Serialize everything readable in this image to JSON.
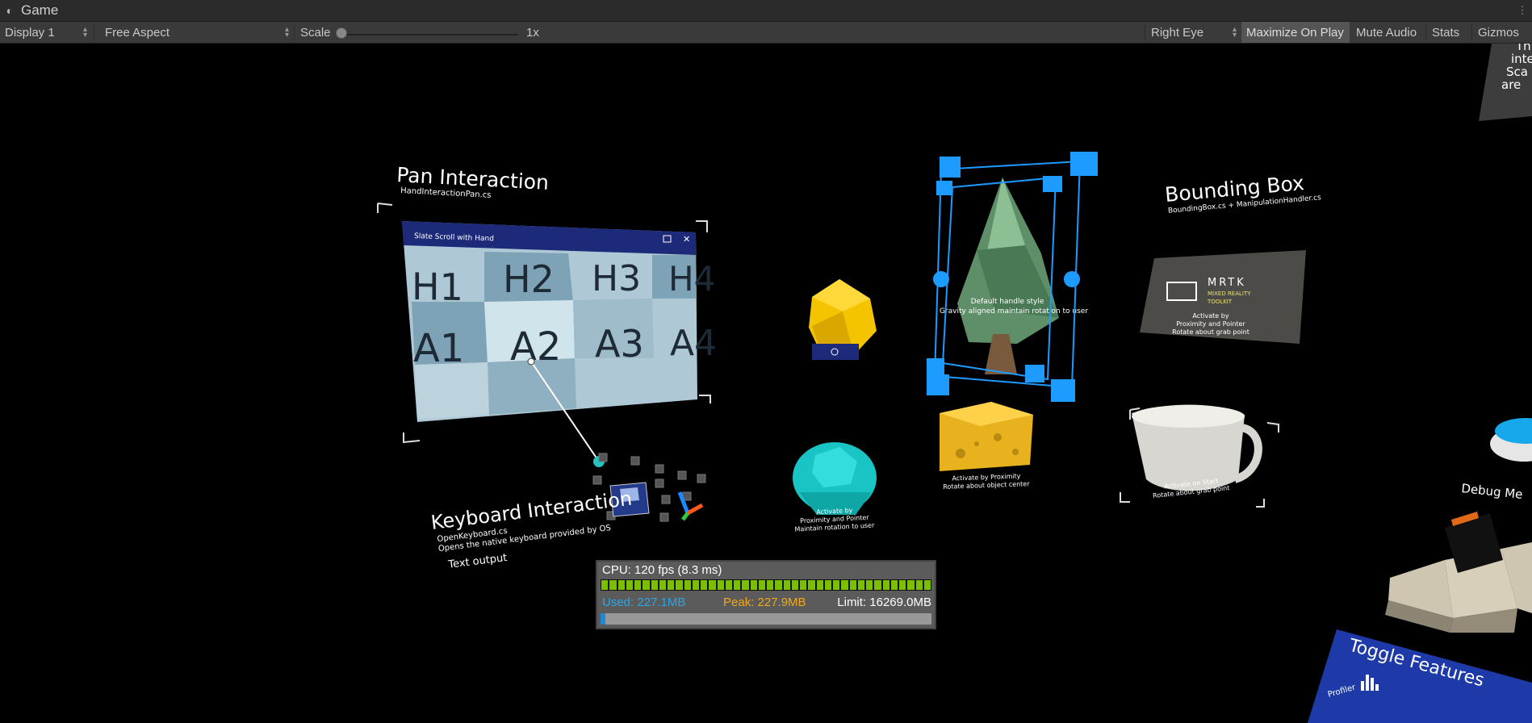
{
  "window": {
    "tab_title": "Game",
    "tab_icon": "game-controller-icon",
    "menu_icon": "kebab-menu-icon"
  },
  "toolbar": {
    "display": "Display 1",
    "aspect": "Free Aspect",
    "scale_label": "Scale",
    "scale_value": "1x",
    "scale_fraction": 0.0,
    "eye": "Right Eye",
    "maximize": "Maximize On Play",
    "mute": "Mute Audio",
    "stats": "Stats",
    "gizmos": "Gizmos"
  },
  "scene": {
    "pan_title": "Pan Interaction",
    "pan_subtitle": "HandInteractionPan.cs",
    "slate_title": "Slate Scroll with Hand",
    "grid_row1": [
      "H1",
      "H2",
      "H3",
      "H4"
    ],
    "grid_row2": [
      "A1",
      "A2",
      "A3",
      "A4"
    ],
    "keyboard_title": "Keyboard Interaction",
    "keyboard_subtitle": "OpenKeyboard.cs",
    "keyboard_desc": "Opens the native keyboard provided by OS",
    "text_output": "Text output",
    "bbox_title": "Bounding Box",
    "bbox_subtitle": "BoundingBox.cs + ManipulationHandler.cs",
    "tree_label1": "Default handle style",
    "tree_label2": "Gravity aligned maintain rotation to user",
    "teal_label1": "Activate by",
    "teal_label2": "Proximity and Pointer",
    "teal_label3": "Maintain rotation to user",
    "cheese_label1": "Activate by Proximity",
    "cheese_label2": "Rotate about object center",
    "mrtk_title": "MRTK",
    "mrtk_sub1": "MIXED REALITY",
    "mrtk_sub2": "TOOLKIT",
    "mrtk_label1": "Activate by",
    "mrtk_label2": "Proximity and Pointer",
    "mrtk_label3": "Rotate about grab point",
    "cup_label1": "Activate on Start",
    "cup_label2": "Rotate about grab point",
    "debug_label": "Debug Me",
    "toggle_title": "Toggle Features",
    "profiler_label": "Profiler",
    "corner_text": [
      "Th",
      "inte",
      "Sca",
      "are"
    ]
  },
  "profiler": {
    "cpu": "CPU: 120 fps (8.3 ms)",
    "used": "Used: 227.1MB",
    "peak": "Peak: 227.9MB",
    "limit": "Limit: 16269.0MB",
    "used_fraction": 0.014
  },
  "colors": {
    "gizmo_blue": "#1e9bff",
    "gem_yellow": "#f5c400",
    "gem_teal": "#19c4c4",
    "cheese": "#e8b21e",
    "slate_header": "#1d2a7a",
    "toggle_panel": "#1d3aa8"
  }
}
